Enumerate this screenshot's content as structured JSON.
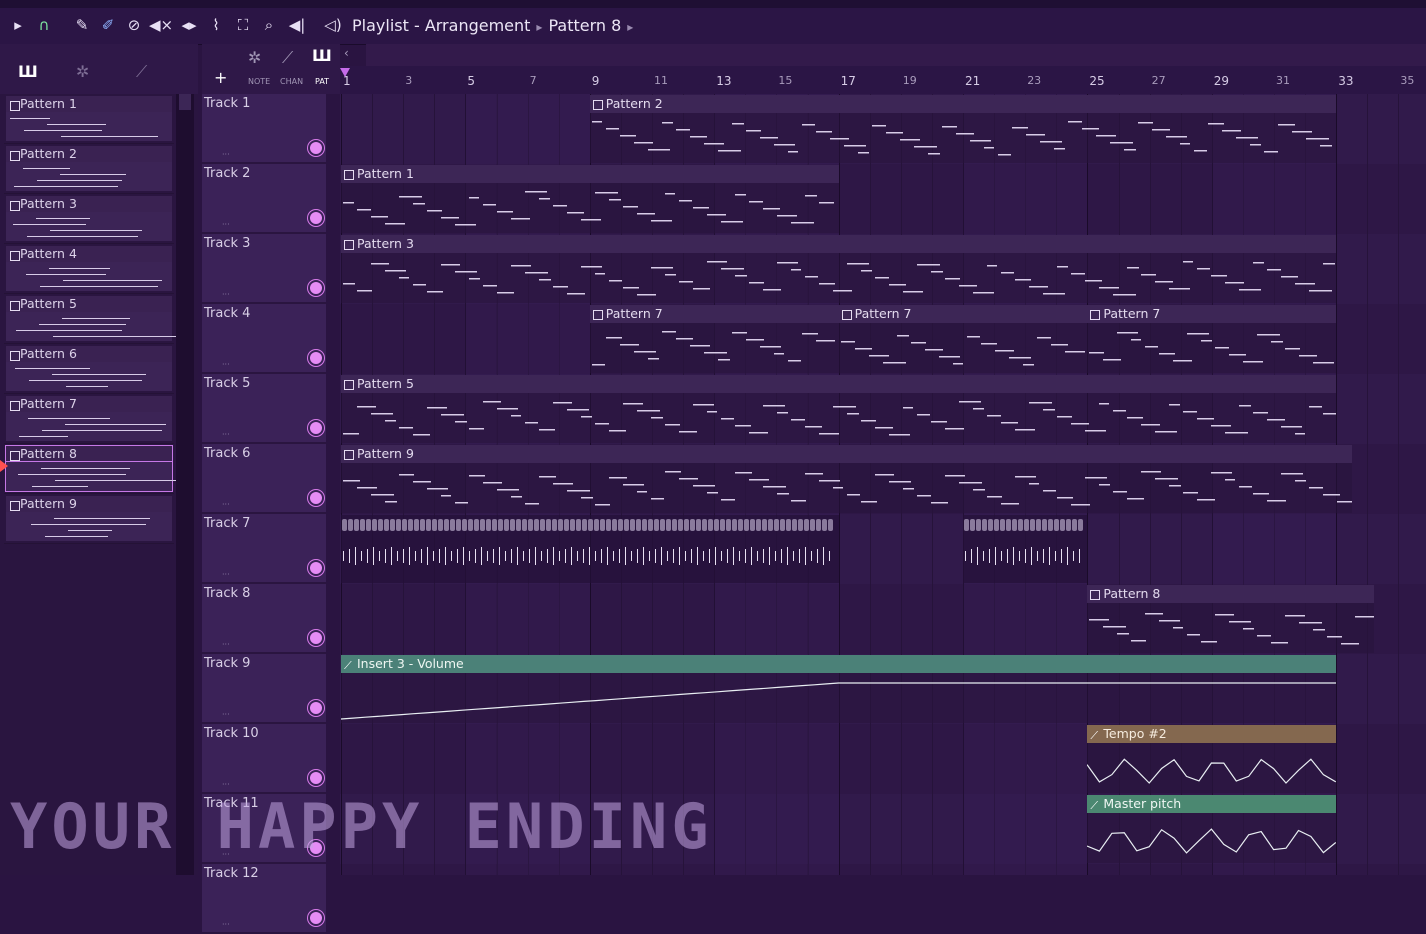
{
  "app": {
    "title": "Playlist - Arrangement",
    "breadcrumb_pattern": "Pattern 8"
  },
  "toolbar": {
    "icons": [
      "play-arrow-icon",
      "magnet-icon",
      "pencil-icon",
      "paint-icon",
      "delete-icon",
      "mute-icon",
      "slip-icon",
      "slice-icon",
      "select-icon",
      "zoom-icon",
      "playback-icon",
      "speaker-icon"
    ]
  },
  "picker": {
    "tabs": [
      "piano-icon",
      "audio-icon",
      "automation-icon"
    ],
    "items": [
      {
        "label": "Pattern 1"
      },
      {
        "label": "Pattern 2"
      },
      {
        "label": "Pattern 3"
      },
      {
        "label": "Pattern 4"
      },
      {
        "label": "Pattern 5"
      },
      {
        "label": "Pattern 6"
      },
      {
        "label": "Pattern 7"
      },
      {
        "label": "Pattern 8",
        "selected": true
      },
      {
        "label": "Pattern 9"
      }
    ]
  },
  "view_buttons": {
    "add": "+",
    "note": "NOTE",
    "chan": "CHAN",
    "pat": "PAT"
  },
  "ruler": {
    "ticks": [
      "1",
      "3",
      "5",
      "7",
      "9",
      "11",
      "13",
      "15",
      "17",
      "19",
      "21",
      "23",
      "25",
      "27",
      "29",
      "31",
      "33",
      "35"
    ]
  },
  "tracks": [
    {
      "name": "Track 1"
    },
    {
      "name": "Track 2"
    },
    {
      "name": "Track 3"
    },
    {
      "name": "Track 4"
    },
    {
      "name": "Track 5"
    },
    {
      "name": "Track 6"
    },
    {
      "name": "Track 7"
    },
    {
      "name": "Track 8"
    },
    {
      "name": "Track 9"
    },
    {
      "name": "Track 10"
    },
    {
      "name": "Track 11"
    },
    {
      "name": "Track 12"
    }
  ],
  "clips": [
    {
      "track": 0,
      "label": "Pattern 2",
      "start": 9,
      "end": 33,
      "kind": "pattern"
    },
    {
      "track": 1,
      "label": "Pattern 1",
      "start": 1,
      "end": 17,
      "kind": "pattern"
    },
    {
      "track": 2,
      "label": "Pattern 3",
      "start": 1,
      "end": 33,
      "kind": "pattern"
    },
    {
      "track": 3,
      "label": "Pattern 7",
      "start": 9,
      "end": 17,
      "kind": "pattern"
    },
    {
      "track": 3,
      "label": "Pattern 7",
      "start": 17,
      "end": 25,
      "kind": "pattern"
    },
    {
      "track": 3,
      "label": "Pattern 7",
      "start": 25,
      "end": 33,
      "kind": "pattern"
    },
    {
      "track": 4,
      "label": "Pattern 5",
      "start": 1,
      "end": 33,
      "kind": "pattern"
    },
    {
      "track": 5,
      "label": "Pattern 9",
      "start": 1,
      "end": 33.5,
      "kind": "pattern"
    },
    {
      "track": 6,
      "label": "",
      "start": 1,
      "end": 17,
      "kind": "audio"
    },
    {
      "track": 6,
      "label": "",
      "start": 21,
      "end": 25,
      "kind": "audio"
    },
    {
      "track": 7,
      "label": "Pattern 8",
      "start": 25,
      "end": 34.2,
      "kind": "pattern"
    },
    {
      "track": 8,
      "label": "Insert 3 - Volume",
      "start": 1,
      "end": 33,
      "kind": "auto"
    },
    {
      "track": 9,
      "label": "Tempo #2",
      "start": 25,
      "end": 33,
      "kind": "tempo"
    },
    {
      "track": 10,
      "label": "Master pitch",
      "start": 25,
      "end": 33,
      "kind": "pitch"
    }
  ],
  "watermark": "YOUR HAPPY ENDING",
  "colors": {
    "accent": "#e58cf5",
    "background": "#2a1441",
    "auto": "#4b8178",
    "tempo": "#84684f"
  }
}
